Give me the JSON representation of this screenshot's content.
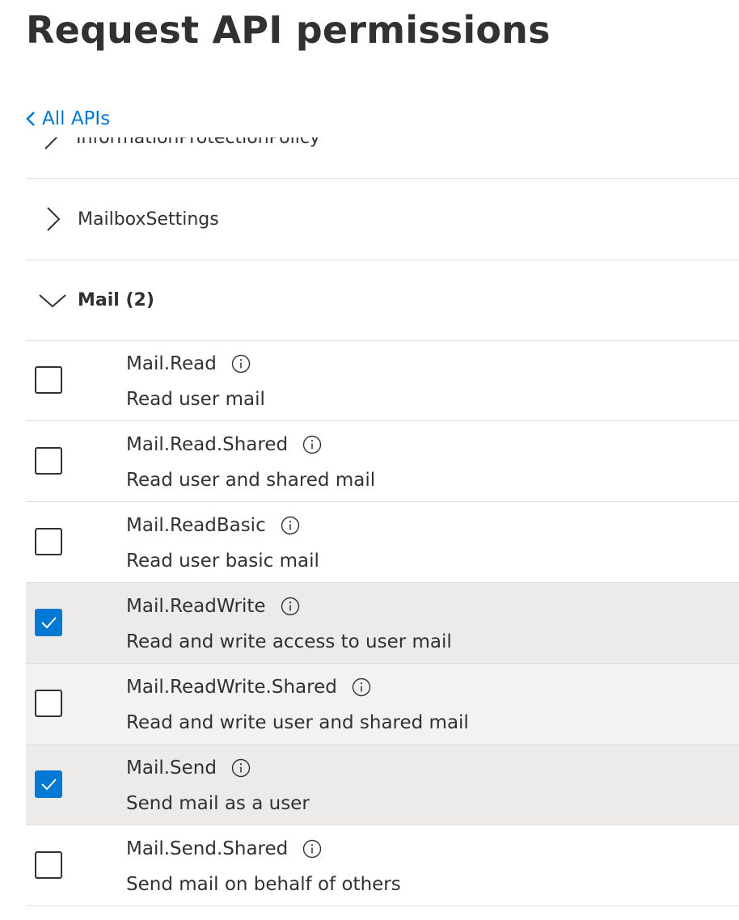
{
  "page": {
    "title": "Request API permissions",
    "back_link": "All APIs"
  },
  "groups": [
    {
      "label": "InformationProtectionPolicy",
      "state": "collapsed",
      "clipped": true
    },
    {
      "label": "MailboxSettings",
      "state": "collapsed"
    },
    {
      "label": "Mail (2)",
      "state": "expanded"
    }
  ],
  "permissions": [
    {
      "name": "Mail.Read",
      "description": "Read user mail",
      "checked": false
    },
    {
      "name": "Mail.Read.Shared",
      "description": "Read user and shared mail",
      "checked": false
    },
    {
      "name": "Mail.ReadBasic",
      "description": "Read user basic mail",
      "checked": false
    },
    {
      "name": "Mail.ReadWrite",
      "description": "Read and write access to user mail",
      "checked": true
    },
    {
      "name": "Mail.ReadWrite.Shared",
      "description": "Read and write user and shared mail",
      "checked": false
    },
    {
      "name": "Mail.Send",
      "description": "Send mail as a user",
      "checked": true
    },
    {
      "name": "Mail.Send.Shared",
      "description": "Send mail on behalf of others",
      "checked": false
    }
  ],
  "icons": {
    "back": "chevron-left-icon",
    "collapsed": "chevron-right-icon",
    "expanded": "chevron-down-icon",
    "info": "info-icon",
    "check": "checkmark-icon"
  },
  "colors": {
    "accent": "#0078d4",
    "text": "#323130",
    "selected_row": "#edebe9",
    "hover_row": "#f3f2f1",
    "divider": "#e1dfdd"
  }
}
